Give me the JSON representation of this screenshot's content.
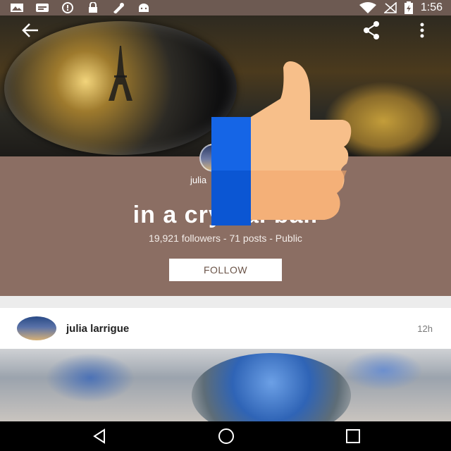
{
  "status_bar": {
    "time": "1:56",
    "icons": [
      "photos-icon",
      "message-icon",
      "alert-icon",
      "lock-icon",
      "tools-icon",
      "android-icon",
      "wifi-icon",
      "signal-icon",
      "battery-icon"
    ]
  },
  "toolbar": {
    "icons": [
      "back-arrow-icon",
      "share-icon",
      "more-vertical-icon"
    ]
  },
  "collection": {
    "owner_name": "julia",
    "title": "in a crystal ball",
    "stats": "19,921 followers - 71 posts - Public",
    "follow_label": "FOLLOW"
  },
  "post": {
    "author": "julia larrigue",
    "time": "12h"
  },
  "colors": {
    "profile_bg": "#8b6e63",
    "status_bg": "#6d5a52",
    "thumb_skin": "#f7b27d",
    "thumb_blue": "#1565e6"
  }
}
